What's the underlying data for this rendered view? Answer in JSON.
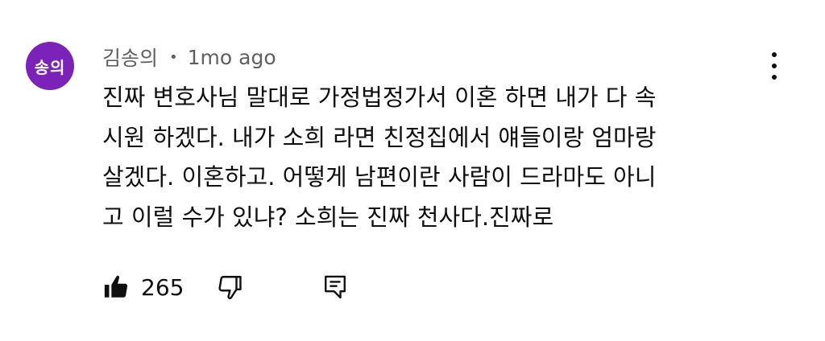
{
  "comment": {
    "avatar_text": "송의",
    "avatar_color": "#7b22b8",
    "author": "김송의",
    "separator": "•",
    "time": "1mo ago",
    "lines": [
      "진짜 변호사님 말대로 가정법정가서 이혼 하면 내가 다 속",
      "시원 하겠다. 내가 소희 라면 친정집에서 얘들이랑 엄마랑",
      "살겠다. 이혼하고. 어떻게 남편이란 사람이 드라마도 아니",
      "고 이럴 수가 있냐? 소희는 진짜 천사다.진짜로"
    ],
    "like_count": "265"
  },
  "icons": {
    "menu": "more-vertical-icon",
    "like": "thumbs-up-icon",
    "dislike": "thumbs-down-icon",
    "reply": "reply-comment-icon"
  }
}
